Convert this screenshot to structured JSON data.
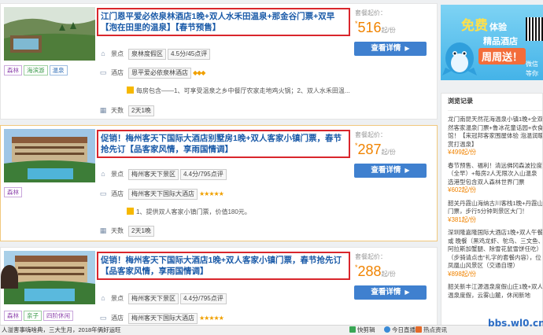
{
  "listings": [
    {
      "title": "江门恩平爱必依泉林酒店1晚+双人水禾田温泉+那金谷门票+双早【泡在田里的温泉】【春节预售】",
      "price_label": "套餐起价：",
      "price": "516",
      "price_unit": "起/份",
      "button": "查看详情",
      "tags": [
        "森林",
        "海滨游",
        "温泉"
      ],
      "scenic_label": "景点",
      "scenic_name": "泉林度假区",
      "scenic_score": "4.5分/45点评",
      "hotel_label": "酒店",
      "hotel_name": "恩平爱必依泉林酒店",
      "hotel_stars": "◆◆◆",
      "note": "每房包含——1、可享受温泉之乡中餐厅农家走地鸡火锅；2、双人水禾田温...",
      "days_label": "天数",
      "days": "2天1晚"
    },
    {
      "title": "促销！梅州客天下国际大酒店别墅房1晚+双人客家小镇门票，春节抢先订【品客家风情，享雨国情调】",
      "price_label": "套餐起价：",
      "price": "287",
      "price_unit": "起/份",
      "button": "查看详情",
      "tags": [
        "森林"
      ],
      "scenic_label": "景点",
      "scenic_name": "梅州客天下景区",
      "scenic_score": "4.4分/795点评",
      "hotel_label": "酒店",
      "hotel_name": "梅州客天下国际大酒店",
      "hotel_stars": "★★★★★",
      "note": "1、提供双人客家小镇门票，价值180元。",
      "days_label": "天数",
      "days": "2天1晚"
    },
    {
      "title": "促销！梅州客天下国际大酒店1晚+双人客家小镇门票，春节抢先订【品客家风情，享雨国情调】",
      "price_label": "套餐起价：",
      "price": "288",
      "price_unit": "起/份",
      "button": "查看详情",
      "tags": [
        "森林",
        "亲子",
        "四阶休闲"
      ],
      "scenic_label": "景点",
      "scenic_name": "梅州客天下景区",
      "scenic_score": "4.4分/795点评",
      "hotel_label": "酒店",
      "hotel_name": "梅州客天下国际大酒店",
      "hotel_stars": "★★★★★"
    }
  ],
  "sidebar": {
    "ad_free": "免费",
    "ad_free_suffix": "体验",
    "ad_line2": "精品酒店",
    "ad_line3": "周周送！",
    "ad_wx1": "微信",
    "ad_wx2": "等你",
    "history_title": "浏览记录",
    "history": [
      {
        "l1": "龙门南昆天然花海温泉小镇1晚+全双早+",
        "l2": "然客家温泉门票+鲁冰花童话园+衣食",
        "l3": "馆！【来冠邦客家围屋体验 泡温润暖",
        "l4": "赏打温泉】",
        "price": "¥499起/份"
      },
      {
        "l1": "春节预售、福利！清远佛冈森波拉度",
        "l2": "（全早）+每房2人无限次入山温泉",
        "l3": "选港型包含双人森林世界门票",
        "price": "¥602起/份"
      },
      {
        "l1": "韶关丹霞山海纳古川客栈1晚+丹霞山",
        "l2": "门票，步行5分钟到景区大门！",
        "price": "¥381起/份"
      },
      {
        "l1": "深圳隆嘉隆国际大酒店1晚+双人午餐",
        "l2": "或 晚餐（黑鸡龙虾、鸵鸟、三文鱼、",
        "l3": "阿拉斯加蟹腿、除雪花鼠雪饼任吃）",
        "l4": "（步骑请点击“礼字的套餐内容），位",
        "l5": "凤凰山风景区（交通自理）",
        "price": "¥898起/份"
      },
      {
        "l1": "韶关新丰江源温泉度假山庄1晚+双人",
        "l2": "温泉度假，云雾山麓，休闲新地"
      }
    ]
  },
  "footer": {
    "marquee": "人溢害事嗨啥典，三大生月，2018年俩好运旺",
    "quick_label": "快剪辑",
    "today_label": "今日直播",
    "hot_label": "热点资讯",
    "watermark": "bbs.wl0.cn"
  },
  "colors": {
    "title_link": "#1a5aa8",
    "price": "#f08300",
    "button": "#3f80cf",
    "highlight_border": "#d9262c"
  }
}
